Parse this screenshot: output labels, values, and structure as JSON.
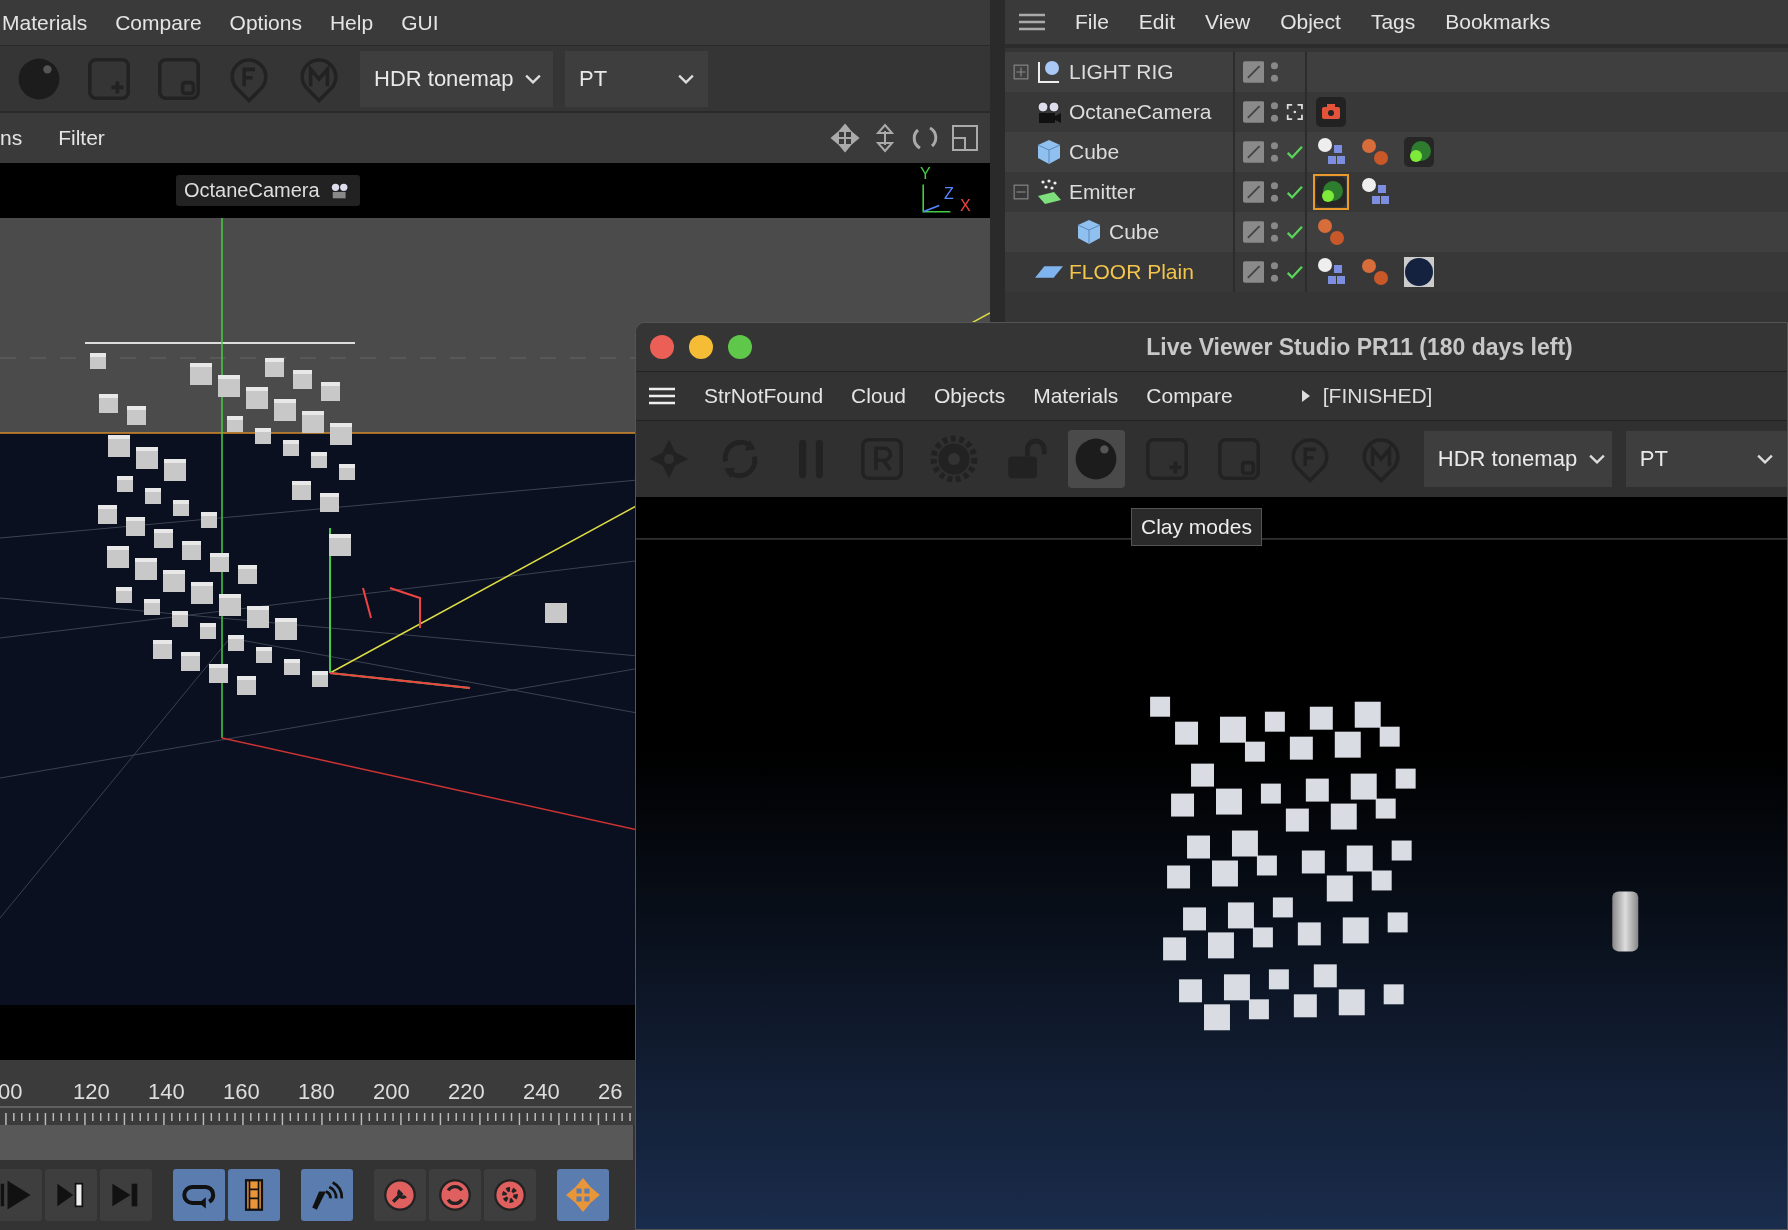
{
  "main_menu": [
    "Materials",
    "Compare",
    "Options",
    "Help",
    "GUI"
  ],
  "main_toolbar": {
    "tools": [
      {
        "kind": "clay",
        "selected": false
      },
      {
        "kind": "add-material",
        "selected": false
      },
      {
        "kind": "material",
        "selected": false
      },
      {
        "kind": "focus-pin",
        "selected": false
      },
      {
        "kind": "material-pin",
        "selected": false
      }
    ],
    "dropdowns": [
      "HDR tonemap",
      "PT"
    ]
  },
  "viewport_menu": [
    "ns",
    "Filter"
  ],
  "viewport": {
    "camera_label": "OctaneCamera",
    "axis_labels": [
      "Y",
      "Z",
      "X"
    ]
  },
  "timeline": {
    "frames": [
      "00",
      "120",
      "140",
      "160",
      "180",
      "200",
      "220",
      "240",
      "26"
    ]
  },
  "transport": [
    {
      "kind": "play"
    },
    {
      "kind": "step-end"
    },
    {
      "kind": "end"
    },
    {
      "kind": "loop"
    },
    {
      "kind": "film"
    },
    {
      "kind": "sound"
    },
    {
      "kind": "key"
    },
    {
      "kind": "auto-key"
    },
    {
      "kind": "key-settings"
    },
    {
      "kind": "move"
    }
  ],
  "object_manager": {
    "menu": [
      "File",
      "Edit",
      "View",
      "Object",
      "Tags",
      "Bookmarks"
    ],
    "objects": [
      {
        "name": "LIGHT RIG",
        "kind": "null",
        "selected": false,
        "expanded": false,
        "checked": false
      },
      {
        "name": "OctaneCamera",
        "kind": "camera",
        "selected": false,
        "tags": [
          {
            "kind": "camera",
            "selected": false
          }
        ]
      },
      {
        "name": "Cube",
        "kind": "cube",
        "selected": false,
        "checked": true,
        "tags": [
          {
            "kind": "object",
            "selected": false
          },
          {
            "kind": "texture",
            "selected": false
          },
          {
            "kind": "light",
            "selected": false
          }
        ]
      },
      {
        "name": "Emitter",
        "kind": "emitter",
        "selected": false,
        "expanded": true,
        "checked": true,
        "tags": [
          {
            "kind": "light",
            "selected": true
          },
          {
            "kind": "object",
            "selected": false
          }
        ],
        "children": [
          {
            "name": "Cube",
            "kind": "cube",
            "selected": false,
            "checked": true,
            "tags": [
              {
                "kind": "texture",
                "selected": false
              }
            ]
          }
        ]
      },
      {
        "name": "FLOOR Plain",
        "kind": "plane",
        "selected": true,
        "checked": true,
        "tags": [
          {
            "kind": "object",
            "selected": false
          },
          {
            "kind": "texture",
            "selected": false
          },
          {
            "kind": "material",
            "selected": false
          }
        ]
      }
    ]
  },
  "live_viewer": {
    "title": "Live Viewer Studio PR11 (180 days left)",
    "menu": [
      "StrNotFound",
      "Cloud",
      "Objects",
      "Materials",
      "Compare"
    ],
    "status": "[FINISHED]",
    "tools": [
      {
        "kind": "octane",
        "selected": false
      },
      {
        "kind": "refresh",
        "selected": false
      },
      {
        "kind": "pause",
        "selected": false
      },
      {
        "kind": "render-region",
        "selected": false
      },
      {
        "kind": "settings",
        "selected": false
      },
      {
        "kind": "lock",
        "selected": false
      },
      {
        "kind": "clay",
        "selected": true
      },
      {
        "kind": "add-material",
        "selected": false
      },
      {
        "kind": "material",
        "selected": false
      },
      {
        "kind": "focus-pin",
        "selected": false
      },
      {
        "kind": "material-pin",
        "selected": false
      }
    ],
    "dropdowns": [
      "HDR tonemap",
      "PT"
    ],
    "tooltip": "Clay modes"
  }
}
